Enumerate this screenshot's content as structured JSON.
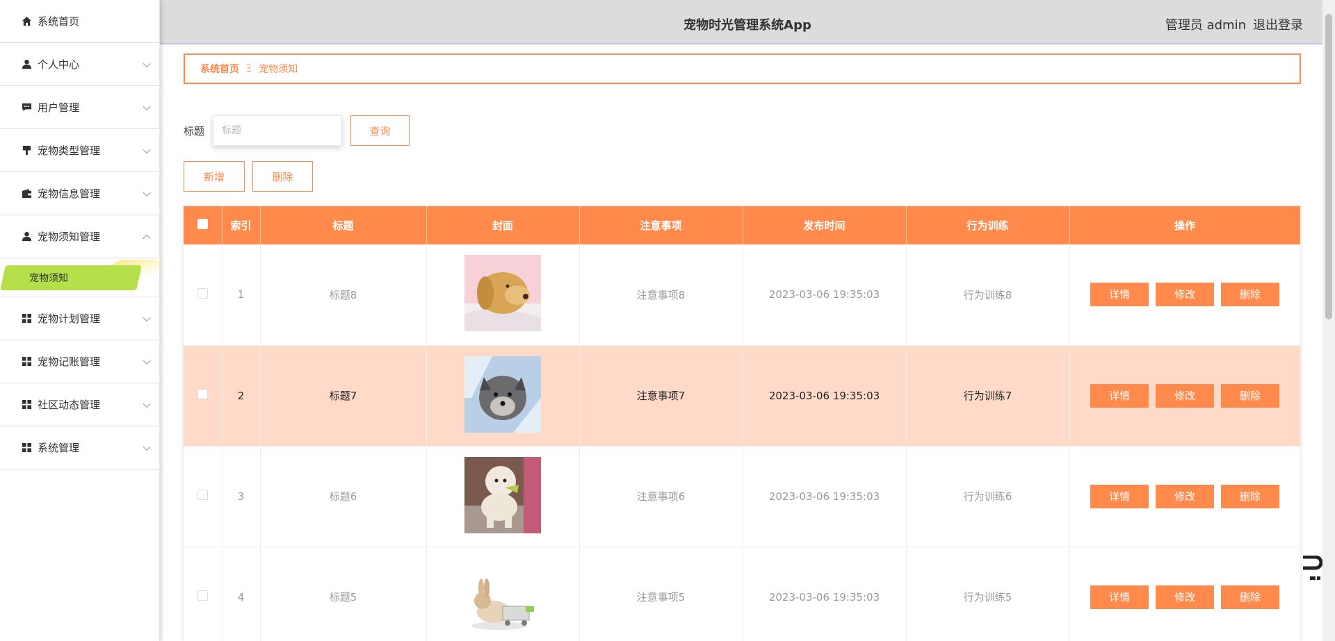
{
  "app": {
    "title": "宠物时光管理系统App",
    "user_label": "管理员 admin",
    "logout_label": "退出登录"
  },
  "sidebar": {
    "items": [
      {
        "label": "系统首页",
        "icon": "home-icon",
        "has_children": false
      },
      {
        "label": "个人中心",
        "icon": "user-icon",
        "has_children": true
      },
      {
        "label": "用户管理",
        "icon": "chat-icon",
        "has_children": true
      },
      {
        "label": "宠物类型管理",
        "icon": "brush-icon",
        "has_children": true
      },
      {
        "label": "宠物信息管理",
        "icon": "wallet-icon",
        "has_children": true
      },
      {
        "label": "宠物须知管理",
        "icon": "user-icon",
        "has_children": true,
        "expanded": true
      },
      {
        "label": "宠物计划管理",
        "icon": "grid-icon",
        "has_children": true
      },
      {
        "label": "宠物记账管理",
        "icon": "grid-icon",
        "has_children": true
      },
      {
        "label": "社区动态管理",
        "icon": "grid-icon",
        "has_children": true
      },
      {
        "label": "系统管理",
        "icon": "grid-icon",
        "has_children": true
      }
    ],
    "active_sub": "宠物须知"
  },
  "breadcrumb": {
    "home": "系统首页",
    "separator": "Ξ",
    "current": "宠物须知"
  },
  "search": {
    "label": "标题",
    "placeholder": "标题",
    "value": "",
    "query_label": "查询"
  },
  "actions": {
    "add_label": "新增",
    "delete_label": "删除"
  },
  "table": {
    "columns": [
      "索引",
      "标题",
      "封面",
      "注意事项",
      "发布时间",
      "行为训练",
      "操作"
    ],
    "rows": [
      {
        "index": "1",
        "title": "标题8",
        "note": "注意事项8",
        "time": "2023-03-06 19:35:03",
        "training": "行为训练8",
        "cover": "puppy-photo"
      },
      {
        "index": "2",
        "title": "标题7",
        "note": "注意事项7",
        "time": "2023-03-06 19:35:03",
        "training": "行为训练7",
        "cover": "terrier-photo"
      },
      {
        "index": "3",
        "title": "标题6",
        "note": "注意事项6",
        "time": "2023-03-06 19:35:03",
        "training": "行为训练6",
        "cover": "poodle-photo"
      },
      {
        "index": "4",
        "title": "标题5",
        "note": "注意事项5",
        "time": "2023-03-06 19:35:03",
        "training": "行为训练5",
        "cover": "rabbit-photo"
      }
    ],
    "row_actions": {
      "detail": "详情",
      "edit": "修改",
      "delete": "删除"
    }
  },
  "colors": {
    "accent": "#ff8a4c",
    "highlight_row": "#ffdac8",
    "active_menu": "#b6e04a"
  }
}
